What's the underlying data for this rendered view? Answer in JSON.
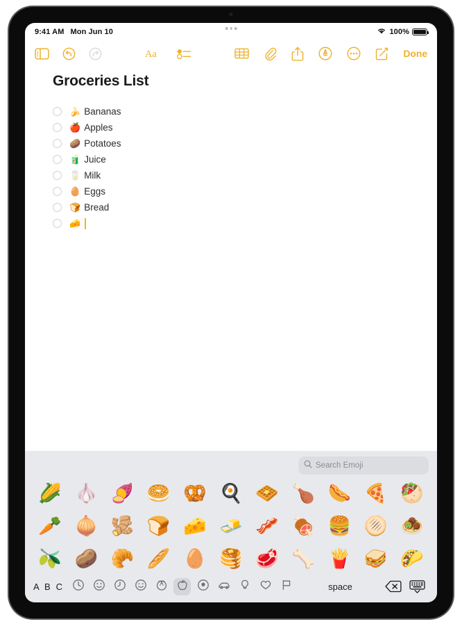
{
  "status_bar": {
    "time": "9:41 AM",
    "date": "Mon Jun 10",
    "battery_percent": "100%",
    "wifi_icon": "wifi-icon",
    "battery_icon": "battery-full-icon",
    "multitask_icon": "multitasking-dots-icon"
  },
  "toolbar": {
    "sidebar_icon": "sidebar-toggle-icon",
    "undo_icon": "undo-icon",
    "redo_icon": "redo-icon",
    "format_icon": "text-format-Aa-icon",
    "checklist_icon": "checklist-icon",
    "table_icon": "table-icon",
    "attachment_icon": "paperclip-icon",
    "share_icon": "share-icon",
    "markup_icon": "markup-pen-icon",
    "more_icon": "more-ellipsis-icon",
    "compose_icon": "compose-new-note-icon",
    "done_label": "Done"
  },
  "note": {
    "title": "Groceries List",
    "items": [
      {
        "emoji": "🍌",
        "text": "Bananas"
      },
      {
        "emoji": "🍎",
        "text": "Apples"
      },
      {
        "emoji": "🥔",
        "text": "Potatoes"
      },
      {
        "emoji": "🧃",
        "text": "Juice"
      },
      {
        "emoji": "🥛",
        "text": "Milk"
      },
      {
        "emoji": "🥚",
        "text": "Eggs"
      },
      {
        "emoji": "🍞",
        "text": "Bread"
      },
      {
        "emoji": "🧀",
        "text": ""
      }
    ]
  },
  "keyboard": {
    "search": {
      "placeholder": "Search Emoji",
      "icon": "search-icon"
    },
    "emoji_rows": [
      [
        "🌽",
        "🧄",
        "🍠",
        "🥯",
        "🥨",
        "🍳",
        "🧇",
        "🍗",
        "🌭",
        "🍕",
        "🥙"
      ],
      [
        "🥕",
        "🧅",
        "🫚",
        "🍞",
        "🧀",
        "🧈",
        "🥓",
        "🍖",
        "🍔",
        "🫓",
        "🧆"
      ],
      [
        "🫒",
        "🥔",
        "🥐",
        "🥖",
        "🥚",
        "🥞",
        "🥩",
        "🦴",
        "🍟",
        "🥪",
        "🌮"
      ]
    ],
    "bottom": {
      "abc_label": "A B C",
      "space_label": "space",
      "delete_icon": "delete-backspace-icon",
      "dismiss_icon": "dismiss-keyboard-icon",
      "categories": [
        {
          "name": "category-recents",
          "icon": "recents-clock-icon",
          "active": false
        },
        {
          "name": "category-frequently-used",
          "icon": "frequently-used-icon",
          "active": false
        },
        {
          "name": "category-clock",
          "icon": "clock-icon",
          "active": false
        },
        {
          "name": "category-smileys",
          "icon": "smiley-face-icon",
          "active": false
        },
        {
          "name": "category-animals",
          "icon": "animals-nature-icon",
          "active": false
        },
        {
          "name": "category-food",
          "icon": "food-apple-icon",
          "active": true
        },
        {
          "name": "category-activities",
          "icon": "activities-ball-icon",
          "active": false
        },
        {
          "name": "category-travel",
          "icon": "travel-car-icon",
          "active": false
        },
        {
          "name": "category-objects",
          "icon": "objects-bulb-icon",
          "active": false
        },
        {
          "name": "category-symbols",
          "icon": "symbols-heart-icon",
          "active": false
        },
        {
          "name": "category-flags",
          "icon": "flags-icon",
          "active": false
        }
      ]
    }
  },
  "colors": {
    "accent": "#ecb22e",
    "keyboard_bg": "#e8e9ed",
    "search_bg": "#dcdde1"
  }
}
